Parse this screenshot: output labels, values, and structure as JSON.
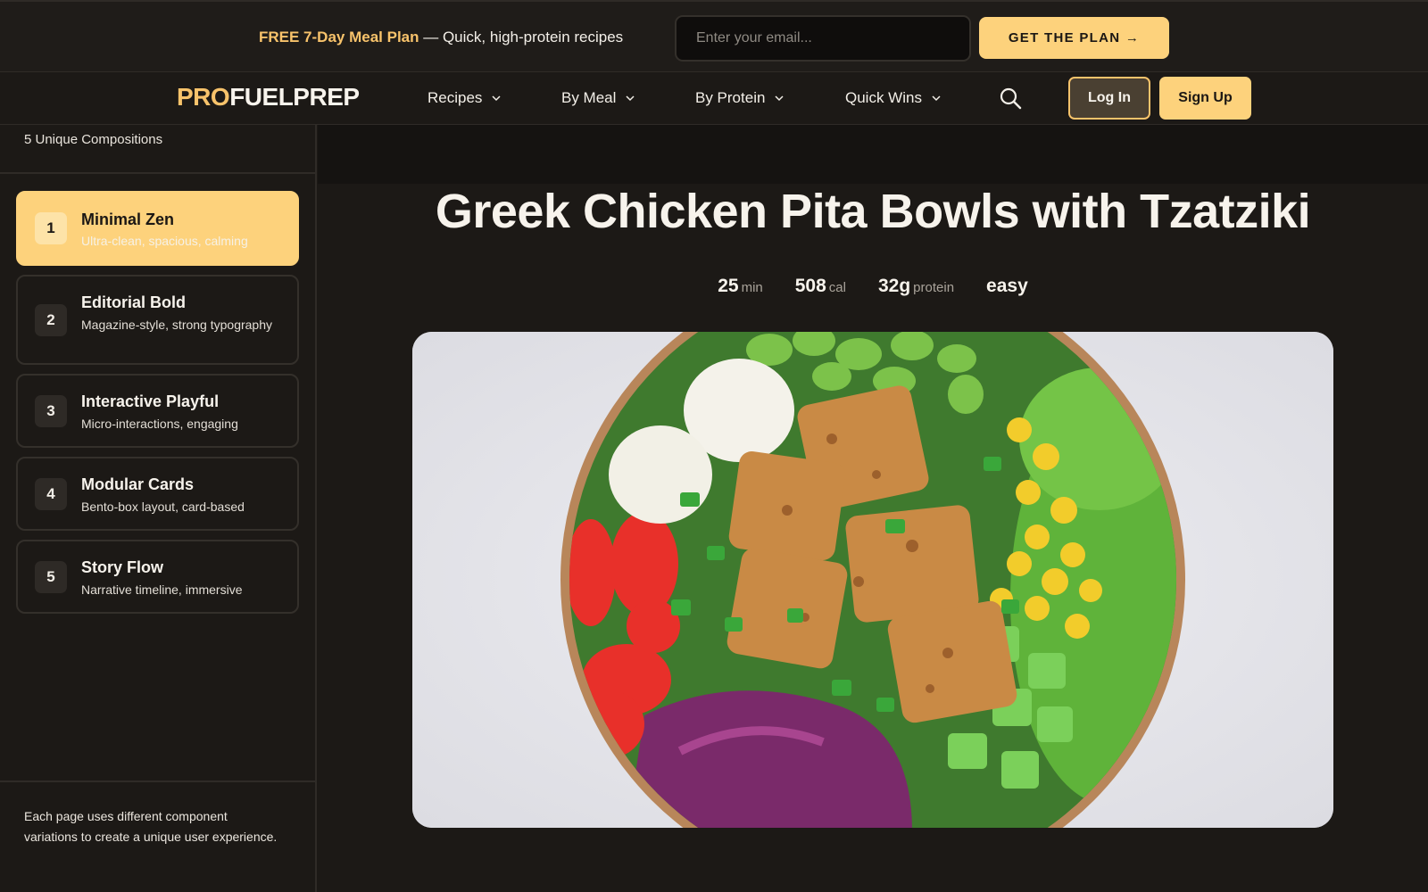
{
  "promo": {
    "highlight": "FREE 7-Day Meal Plan",
    "text": " — Quick, high-protein recipes",
    "email_placeholder": "Enter your email...",
    "cta_label": "GET THE PLAN →"
  },
  "nav": {
    "logo_part1": "PRO",
    "logo_part2": "FUELPREP",
    "items": [
      {
        "label": "Recipes"
      },
      {
        "label": "By Meal"
      },
      {
        "label": "By Protein"
      },
      {
        "label": "Quick Wins"
      }
    ],
    "login_label": "Log In",
    "signup_label": "Sign Up"
  },
  "sidebar": {
    "subtitle": "5 Unique Compositions",
    "compositions": [
      {
        "num": "1",
        "title": "Minimal Zen",
        "desc": "Ultra-clean, spacious, calming",
        "active": true
      },
      {
        "num": "2",
        "title": "Editorial Bold",
        "desc": "Magazine-style, strong typography",
        "active": false
      },
      {
        "num": "3",
        "title": "Interactive Playful",
        "desc": "Micro-interactions, engaging",
        "active": false
      },
      {
        "num": "4",
        "title": "Modular Cards",
        "desc": "Bento-box layout, card-based",
        "active": false
      },
      {
        "num": "5",
        "title": "Story Flow",
        "desc": "Narrative timeline, immersive",
        "active": false
      }
    ],
    "footer": "Each page uses different component variations to create a unique user experience."
  },
  "recipe": {
    "title": "Greek Chicken Pita Bowls with Tzatziki",
    "stats": {
      "time_value": "25",
      "time_unit": "min",
      "cal_value": "508",
      "cal_unit": "cal",
      "protein_value": "32g",
      "protein_unit": "protein",
      "difficulty": "easy"
    }
  },
  "colors": {
    "accent": "#fdd27c",
    "accent_text": "#f8c36b",
    "background": "#1c1916"
  },
  "icons": {
    "search": "search-icon",
    "chevron": "chevron-down-icon"
  }
}
